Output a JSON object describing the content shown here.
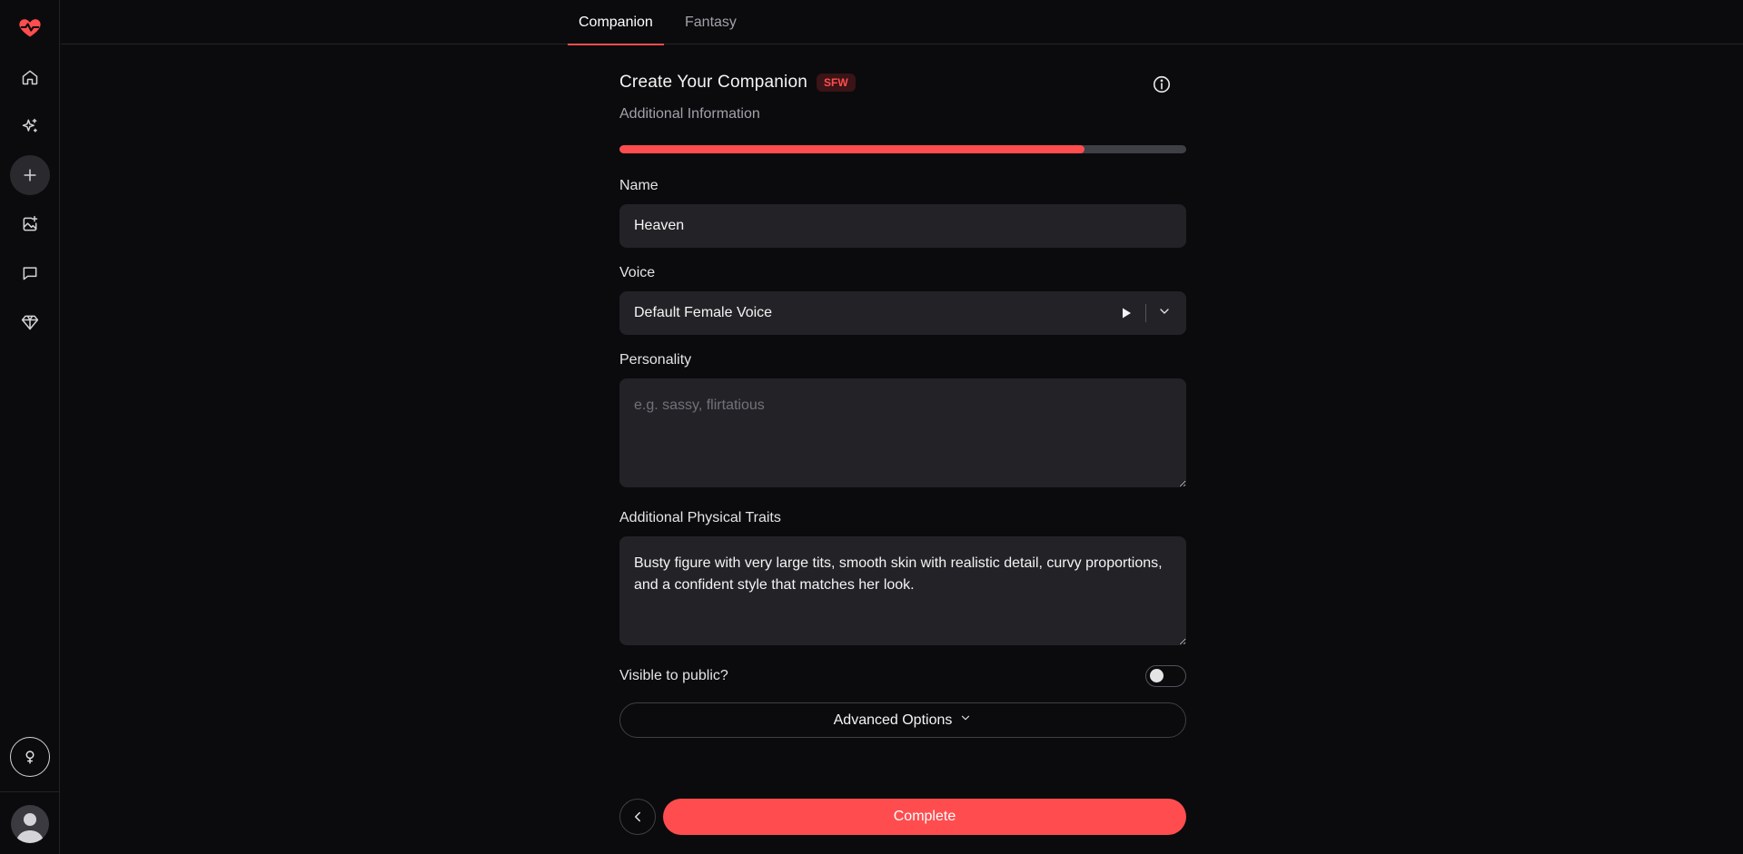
{
  "app": {
    "accent": "#ff4d4f"
  },
  "sidebar": {
    "items": [
      {
        "icon": "heart-pulse-logo-icon"
      },
      {
        "icon": "home-icon"
      },
      {
        "icon": "sparkles-icon"
      },
      {
        "icon": "plus-icon"
      },
      {
        "icon": "image-plus-icon"
      },
      {
        "icon": "chat-icon"
      },
      {
        "icon": "diamond-icon"
      },
      {
        "icon": "female-symbol-icon"
      },
      {
        "icon": "user-avatar-icon"
      }
    ]
  },
  "tabs": [
    {
      "label": "Companion",
      "active": true
    },
    {
      "label": "Fantasy",
      "active": false
    }
  ],
  "form": {
    "title": "Create Your Companion",
    "badge": "SFW",
    "subtitle": "Additional Information",
    "progress": 0.82,
    "name": {
      "label": "Name",
      "value": "Heaven"
    },
    "voice": {
      "label": "Voice",
      "value": "Default Female Voice"
    },
    "personality": {
      "label": "Personality",
      "placeholder": "e.g. sassy, flirtatious",
      "value": ""
    },
    "traits": {
      "label": "Additional Physical Traits",
      "value": "Busty figure with very large tits, smooth skin with realistic detail, curvy proportions, and a confident style that matches her look."
    },
    "visibility": {
      "label": "Visible to public?",
      "on": false
    },
    "advanced_label": "Advanced Options",
    "complete_label": "Complete"
  }
}
